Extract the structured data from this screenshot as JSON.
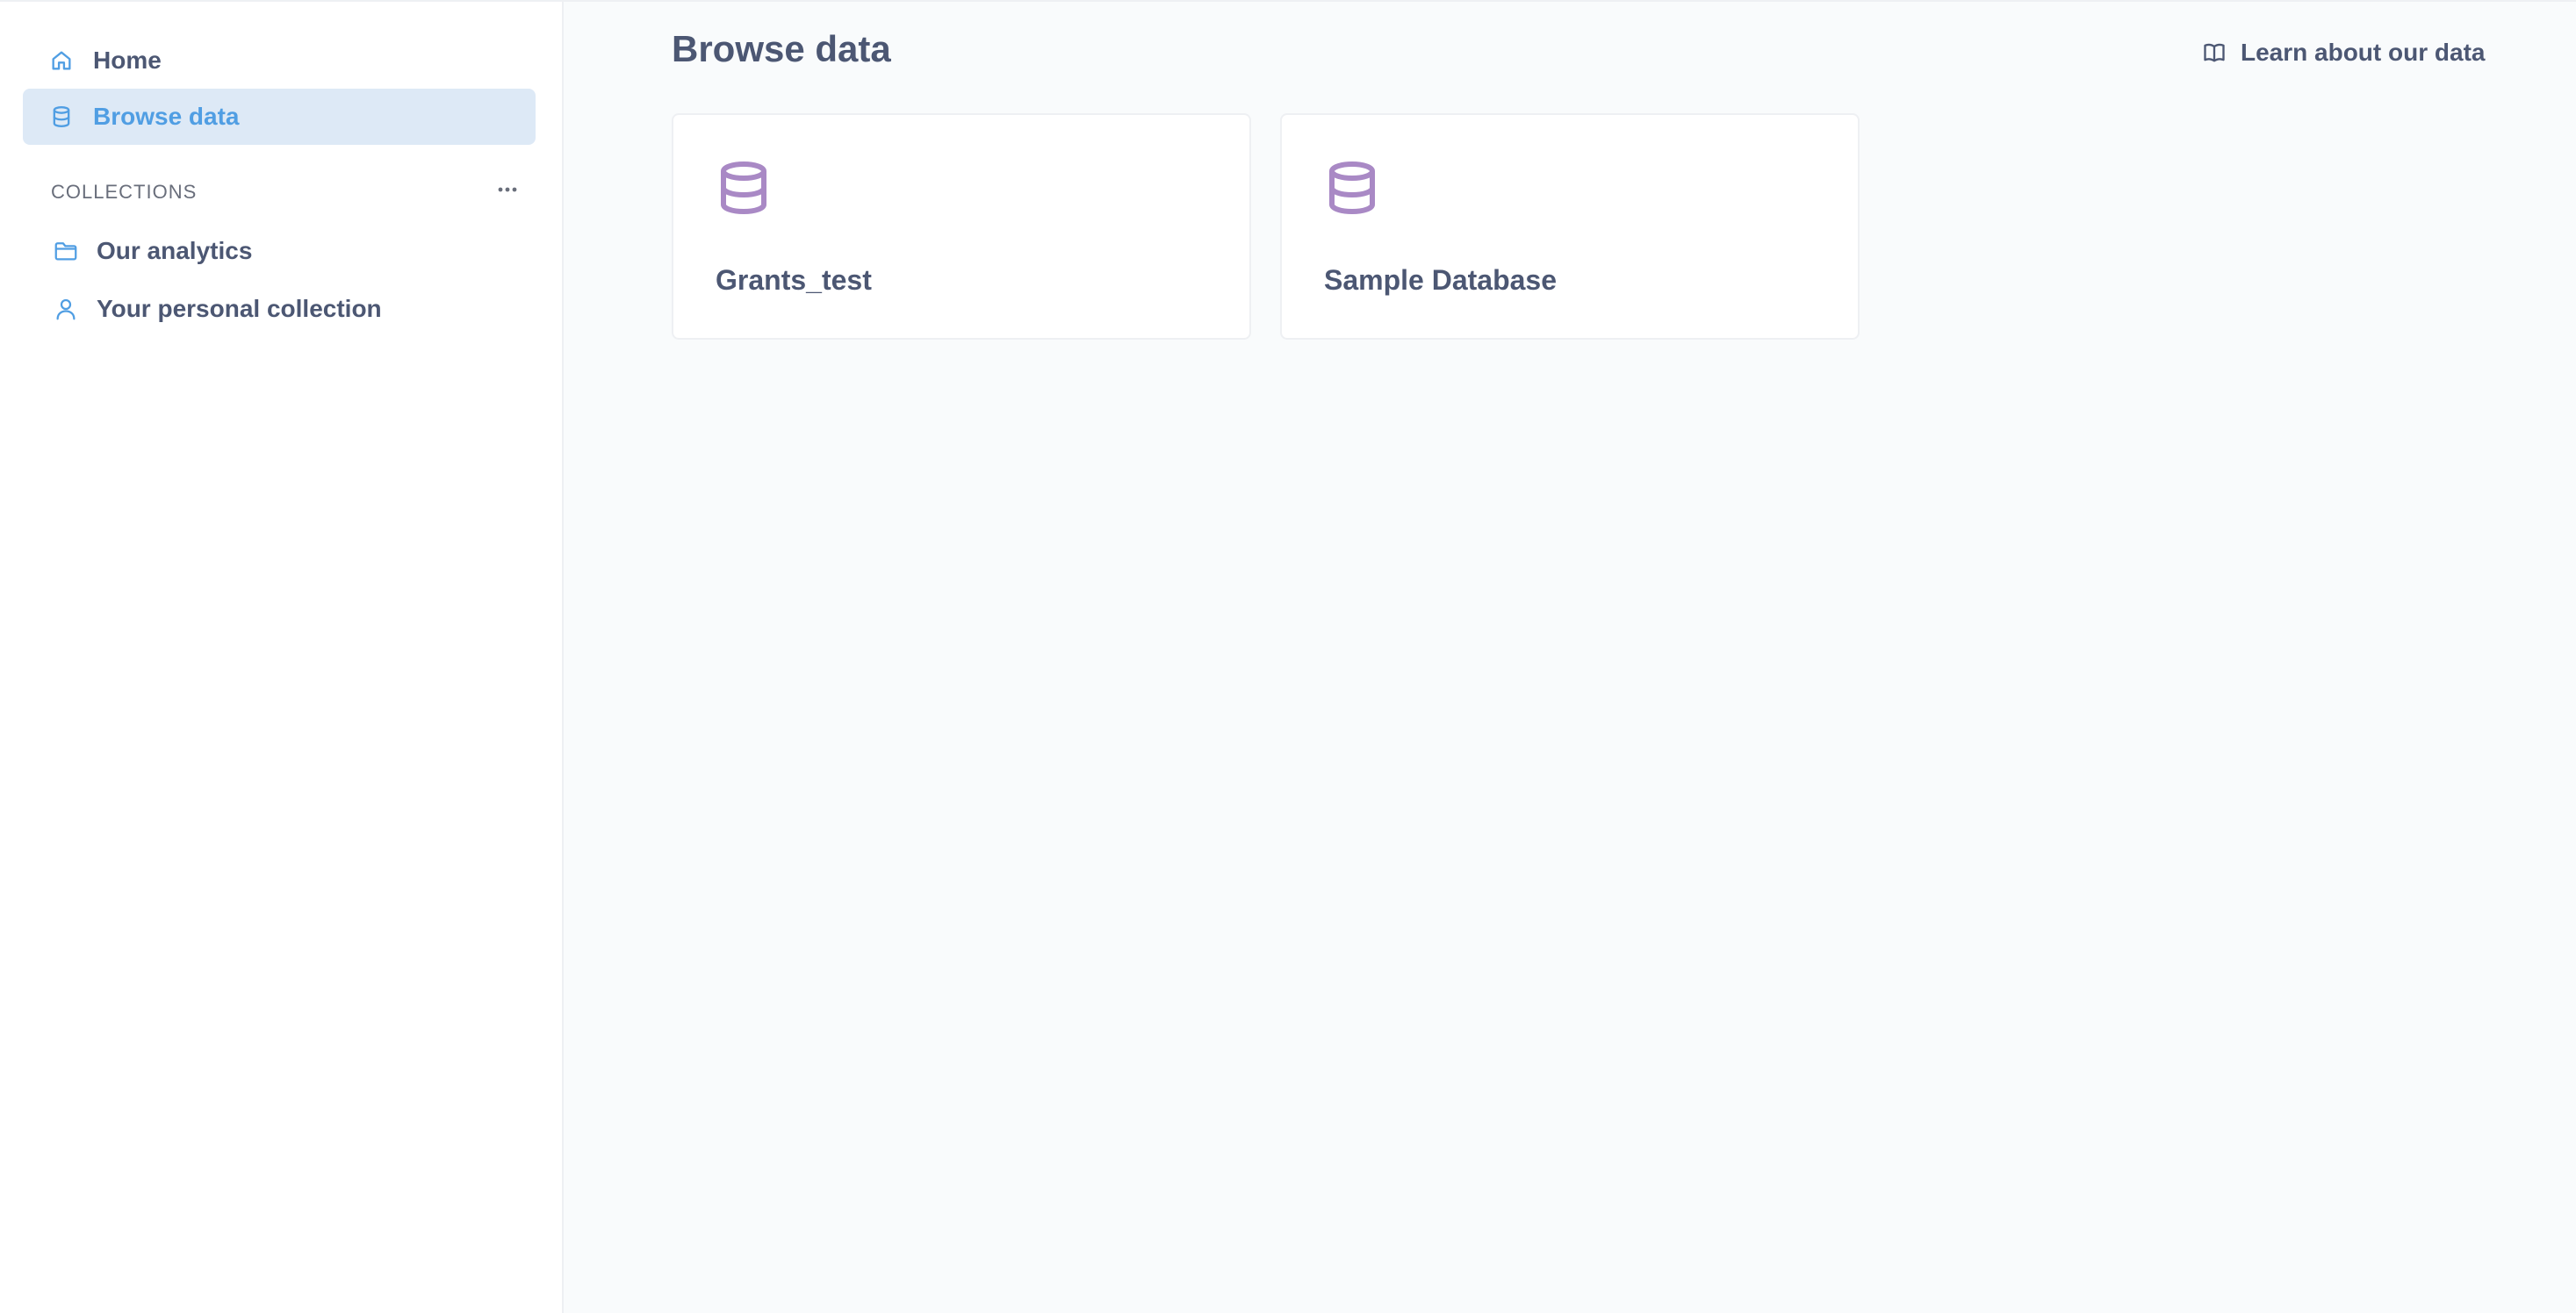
{
  "sidebar": {
    "nav": [
      {
        "label": "Home",
        "icon": "home-icon",
        "active": false
      },
      {
        "label": "Browse data",
        "icon": "database-icon",
        "active": true
      }
    ],
    "collections_header": "COLLECTIONS",
    "collections": [
      {
        "label": "Our analytics",
        "icon": "folder-icon"
      },
      {
        "label": "Your personal collection",
        "icon": "person-icon"
      }
    ]
  },
  "main": {
    "title": "Browse data",
    "learn_link": "Learn about our data",
    "databases": [
      {
        "name": "Grants_test",
        "icon": "database-icon"
      },
      {
        "name": "Sample Database",
        "icon": "database-icon"
      }
    ]
  },
  "colors": {
    "accent": "#509ee3",
    "active_bg": "#dde9f6",
    "database_icon": "#a989c5",
    "text": "#4c5773"
  }
}
